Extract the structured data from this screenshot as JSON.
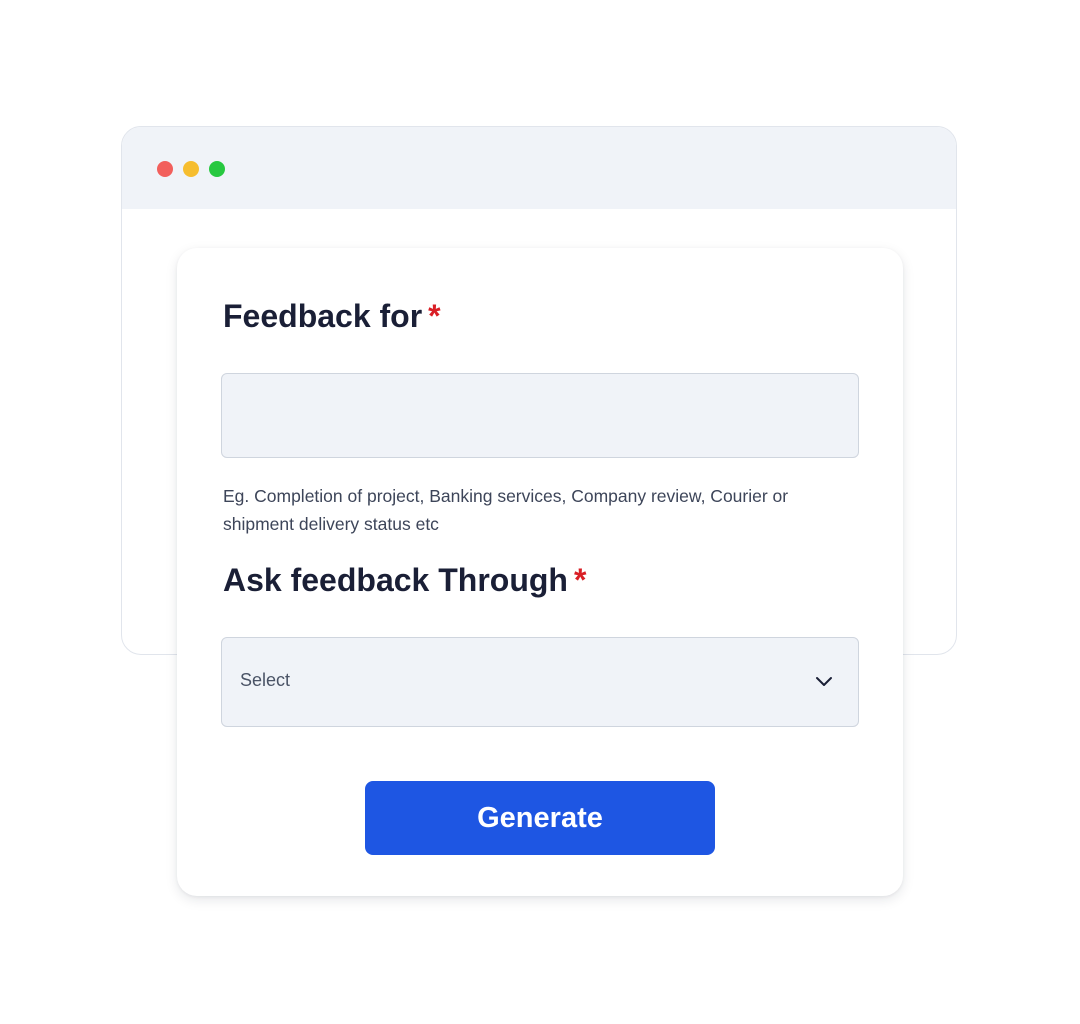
{
  "window": {
    "controls": [
      {
        "name": "close",
        "color": "#f25f5c"
      },
      {
        "name": "minimize",
        "color": "#f6bd2f"
      },
      {
        "name": "maximize",
        "color": "#27c840"
      }
    ]
  },
  "form": {
    "feedback_for": {
      "label": "Feedback for",
      "required_mark": "*",
      "value": "",
      "help_text": "Eg. Completion of project, Banking services, Company review, Courier or shipment delivery status etc"
    },
    "ask_through": {
      "label": "Ask feedback Through",
      "required_mark": "*",
      "selected": "Select",
      "icon": "chevron-down-icon"
    },
    "submit_label": "Generate"
  },
  "colors": {
    "accent": "#1e56e3",
    "required": "#d91f26",
    "field_bg": "#f0f3f8"
  }
}
